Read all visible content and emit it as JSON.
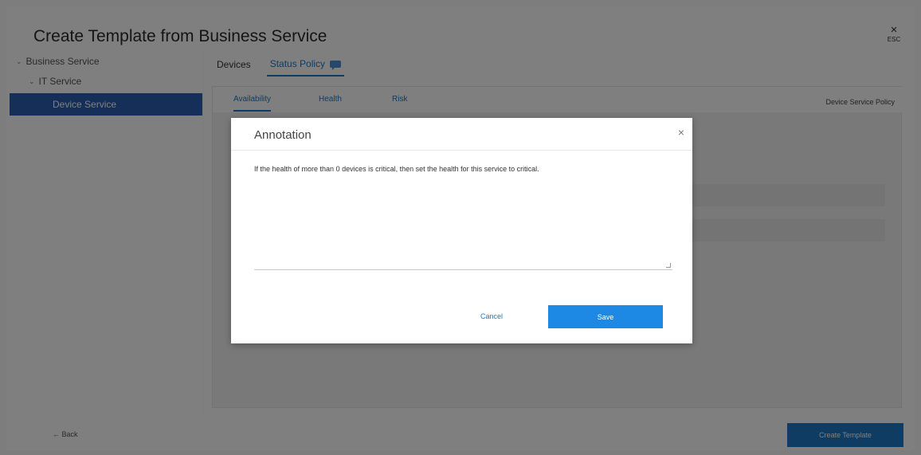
{
  "header": {
    "title": "Create Template from Business Service",
    "close_glyph": "×",
    "close_label": "ESC"
  },
  "tree": {
    "items": [
      {
        "label": "Business Service",
        "icon": "chevron-down-icon"
      },
      {
        "label": "IT Service",
        "icon": "chevron-down-icon"
      },
      {
        "label": "Device Service",
        "selected": true
      }
    ]
  },
  "main": {
    "tabs": [
      {
        "label": "Devices"
      },
      {
        "label": "Status Policy",
        "icon": "annotation-icon"
      }
    ],
    "subtabs": [
      {
        "label": "Availability"
      },
      {
        "label": "Health"
      },
      {
        "label": "Risk"
      }
    ],
    "policy_label": "Device Service Policy"
  },
  "footer": {
    "back_label": "← Back",
    "create_label": "Create Template"
  },
  "modal": {
    "title": "Annotation",
    "close_glyph": "×",
    "annotation_text": "If the health of more than 0 devices is critical, then set the health for this service to critical.",
    "cancel_label": "Cancel",
    "save_label": "Save"
  },
  "colors": {
    "accent": "#1f78c4",
    "selected_bg": "#2a5fb0",
    "save_button": "#1e88e5"
  }
}
